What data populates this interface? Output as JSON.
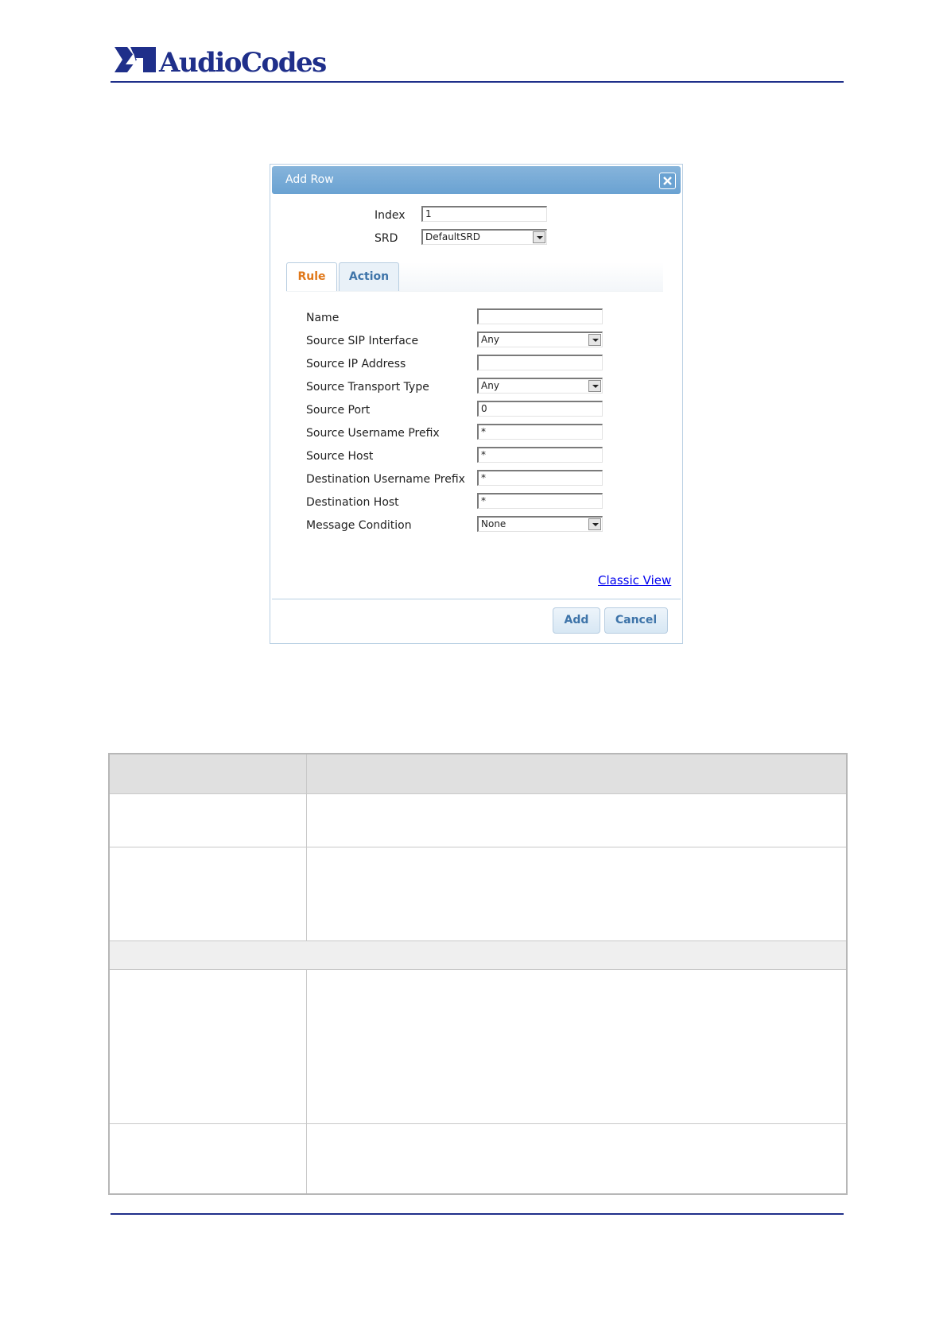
{
  "header": {
    "brand_name": "AudioCodes"
  },
  "dialog": {
    "title": "Add Row",
    "index": {
      "label": "Index",
      "value": "1"
    },
    "srd": {
      "label": "SRD",
      "value": "DefaultSRD"
    },
    "tabs": [
      {
        "label": "Rule",
        "active": true
      },
      {
        "label": "Action",
        "active": false
      }
    ],
    "rule_fields": [
      {
        "label": "Name",
        "kind": "text",
        "value": ""
      },
      {
        "label": "Source SIP Interface",
        "kind": "select",
        "value": "Any"
      },
      {
        "label": "Source IP Address",
        "kind": "text",
        "value": ""
      },
      {
        "label": "Source Transport Type",
        "kind": "select",
        "value": "Any"
      },
      {
        "label": "Source Port",
        "kind": "text",
        "value": "0"
      },
      {
        "label": "Source Username Prefix",
        "kind": "text",
        "value": "*"
      },
      {
        "label": "Source Host",
        "kind": "text",
        "value": "*"
      },
      {
        "label": "Destination Username Prefix",
        "kind": "text",
        "value": "*"
      },
      {
        "label": "Destination Host",
        "kind": "text",
        "value": "*"
      },
      {
        "label": "Message Condition",
        "kind": "select",
        "value": "None"
      }
    ],
    "classic_view_link": "Classic View",
    "add_label": "Add",
    "cancel_label": "Cancel"
  },
  "colors": {
    "brand_blue": "#1f2f8a",
    "title_bar": "#6aa2d2",
    "active_tab_text": "#e0781a",
    "inactive_tab_text": "#3e74a9"
  }
}
